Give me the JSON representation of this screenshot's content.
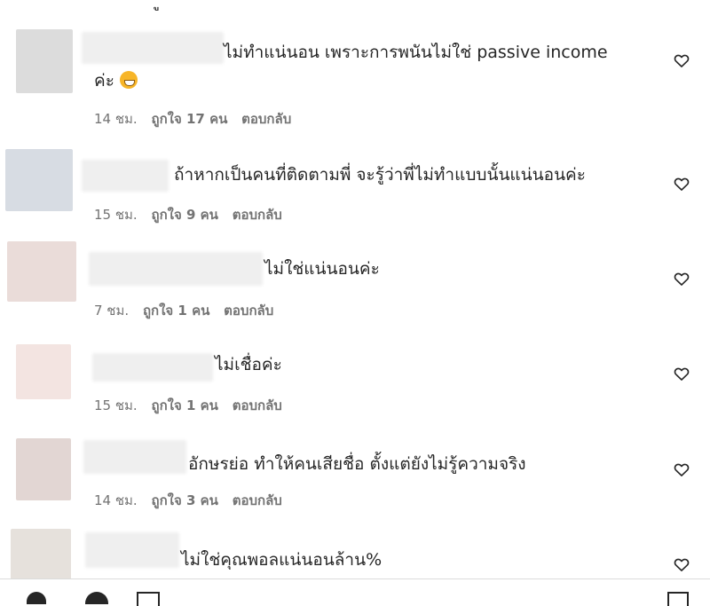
{
  "top_partial_text": "ู",
  "comments": [
    {
      "avatar_color": "#dcdcdc",
      "text_line1": "ไม่ทำแน่นอน เพราะการพนันไม่ใช่ passive income",
      "text_line2": "ค่ะ",
      "emoji": "grimacing-face-emoji",
      "time": "14 ชม.",
      "likes": "ถูกใจ 17 คน",
      "reply": "ตอบกลับ"
    },
    {
      "avatar_color": "#d7dce3",
      "text_line1": "ถ้าหากเป็นคนที่ติดตามพี่ จะรู้ว่าพี่ไม่ทำแบบนั้นแน่นอนค่ะ",
      "time": "15 ชม.",
      "likes": "ถูกใจ 9 คน",
      "reply": "ตอบกลับ"
    },
    {
      "avatar_color": "#eadcd9",
      "text_line1": "ไม่ใช่แน่นอนค่ะ",
      "time": "7 ชม.",
      "likes": "ถูกใจ 1 คน",
      "reply": "ตอบกลับ"
    },
    {
      "avatar_color": "#f3e4e1",
      "text_line1": "ไม่เชื่อค่ะ",
      "time": "15 ชม.",
      "likes": "ถูกใจ 1 คน",
      "reply": "ตอบกลับ"
    },
    {
      "avatar_color": "#e2d6d3",
      "text_line1": "อักษรย่อ ทำให้คนเสียชื่อ ตั้งแต่ยังไม่รู้ความจริง",
      "time": "14 ชม.",
      "likes": "ถูกใจ 3 คน",
      "reply": "ตอบกลับ"
    },
    {
      "avatar_color": "#e6e1dc",
      "text_line1": "ไม่ใช่คุณพอลแน่นอนล้าน%",
      "time": "",
      "likes": "",
      "reply": ""
    }
  ],
  "icons": {
    "like": "heart-outline-icon"
  }
}
